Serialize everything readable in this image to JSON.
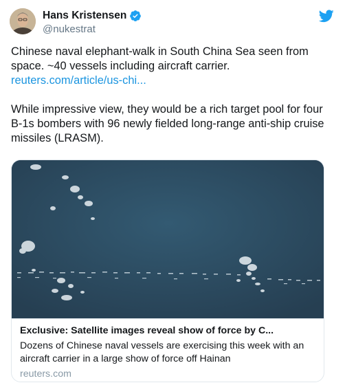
{
  "user": {
    "display_name": "Hans Kristensen",
    "handle": "@nukestrat",
    "verified": true,
    "avatar_icon": "profile-photo"
  },
  "brand": {
    "icon": "twitter-bird-icon",
    "color": "#1da1f2"
  },
  "tweet": {
    "line1": "Chinese naval elephant-walk in South China Sea seen from space. ~40 vessels including aircraft carrier.",
    "link_text": "reuters.com/article/us-chi...",
    "line2": "While impressive view, they would be a rich target pool for four B-1s bombers with 96 newly fielded long-range anti-ship cruise missiles (LRASM)."
  },
  "card": {
    "image_description_icon": "satellite-image",
    "title": "Exclusive: Satellite images reveal show of force by C...",
    "description": "Dozens of Chinese naval vessels are exercising this week with an aircraft carrier in a large show of force off Hainan",
    "domain": "reuters.com"
  },
  "colors": {
    "text": "#14171a",
    "secondary": "#657786",
    "link": "#1b95e0",
    "sea": "#2d4d62",
    "border": "#e1e8ed"
  }
}
